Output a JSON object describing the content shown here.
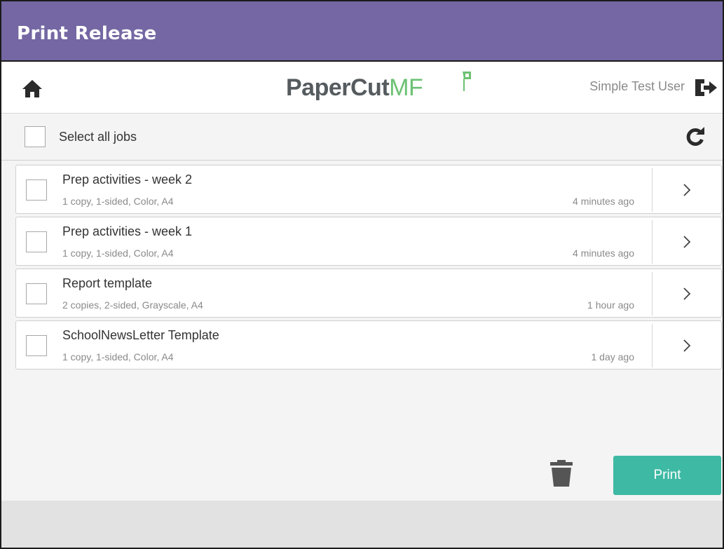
{
  "app": {
    "title": "Print Release"
  },
  "header": {
    "logo_text_main": "PaperCut",
    "logo_text_accent": "MF",
    "user_name": "Simple Test User",
    "home_icon": "home-icon",
    "logout_icon": "logout-icon"
  },
  "select_all": {
    "label": "Select all jobs",
    "checked": false,
    "refresh_icon": "refresh-icon"
  },
  "jobs": [
    {
      "name": "Prep activities - week 2",
      "details": "1 copy, 1-sided, Color, A4",
      "time": "4 minutes ago",
      "checked": false
    },
    {
      "name": "Prep activities - week 1",
      "details": "1 copy, 1-sided, Color, A4",
      "time": "4 minutes ago",
      "checked": false
    },
    {
      "name": "Report template",
      "details": "2 copies, 2-sided, Grayscale, A4",
      "time": "1 hour ago",
      "checked": false
    },
    {
      "name": "SchoolNewsLetter Template",
      "details": "1 copy, 1-sided, Color, A4",
      "time": "1 day ago",
      "checked": false
    }
  ],
  "actions": {
    "delete_icon": "trash-icon",
    "print_label": "Print"
  },
  "colors": {
    "titlebar": "#7567a3",
    "print_button": "#3eb9a4",
    "logo_accent": "#6cc173",
    "logo_main": "#555b5e"
  }
}
